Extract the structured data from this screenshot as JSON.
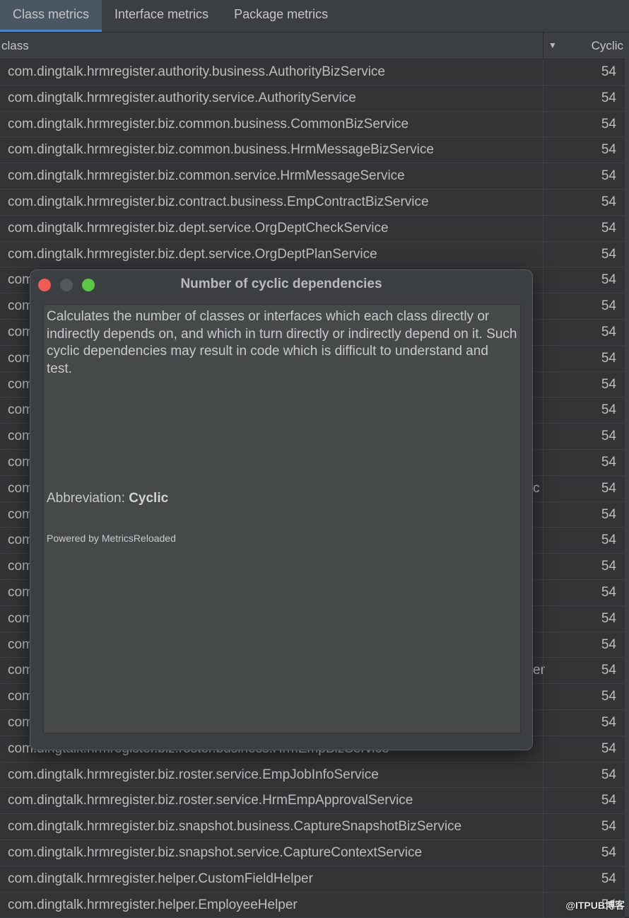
{
  "tabs": [
    {
      "label": "Class metrics",
      "active": true
    },
    {
      "label": "Interface metrics",
      "active": false
    },
    {
      "label": "Package metrics",
      "active": false
    }
  ],
  "table": {
    "columns": {
      "class": "class",
      "sort_icon": "sort-descending-icon",
      "cyclic": "Cyclic"
    },
    "rows": [
      {
        "name": "com.dingtalk.hrmregister.authority.business.AuthorityBizService",
        "value": "54"
      },
      {
        "name": "com.dingtalk.hrmregister.authority.service.AuthorityService",
        "value": "54"
      },
      {
        "name": "com.dingtalk.hrmregister.biz.common.business.CommonBizService",
        "value": "54"
      },
      {
        "name": "com.dingtalk.hrmregister.biz.common.business.HrmMessageBizService",
        "value": "54"
      },
      {
        "name": "com.dingtalk.hrmregister.biz.common.service.HrmMessageService",
        "value": "54"
      },
      {
        "name": "com.dingtalk.hrmregister.biz.contract.business.EmpContractBizService",
        "value": "54"
      },
      {
        "name": "com.dingtalk.hrmregister.biz.dept.service.OrgDeptCheckService",
        "value": "54"
      },
      {
        "name": "com.dingtalk.hrmregister.biz.dept.service.OrgDeptPlanService",
        "value": "54"
      },
      {
        "name": "com",
        "value": "54"
      },
      {
        "name": "com",
        "value": "54"
      },
      {
        "name": "com",
        "value": "54"
      },
      {
        "name": "com",
        "value": "54"
      },
      {
        "name": "com",
        "value": "54"
      },
      {
        "name": "com",
        "value": "54"
      },
      {
        "name": "com",
        "value": "54"
      },
      {
        "name": "com",
        "value": "54"
      },
      {
        "name": "com",
        "value": "54",
        "tail": "c"
      },
      {
        "name": "com",
        "value": "54"
      },
      {
        "name": "com",
        "value": "54"
      },
      {
        "name": "com",
        "value": "54"
      },
      {
        "name": "com",
        "value": "54"
      },
      {
        "name": "com",
        "value": "54"
      },
      {
        "name": "com",
        "value": "54"
      },
      {
        "name": "com",
        "value": "54",
        "tail": "er"
      },
      {
        "name": "com",
        "value": "54"
      },
      {
        "name": "com",
        "value": "54"
      },
      {
        "name": "com.dingtalk.hrmregister.biz.roster.business.HrmEmpBizService",
        "value": "54"
      },
      {
        "name": "com.dingtalk.hrmregister.biz.roster.service.EmpJobInfoService",
        "value": "54"
      },
      {
        "name": "com.dingtalk.hrmregister.biz.roster.service.HrmEmpApprovalService",
        "value": "54"
      },
      {
        "name": "com.dingtalk.hrmregister.biz.snapshot.business.CaptureSnapshotBizService",
        "value": "54"
      },
      {
        "name": "com.dingtalk.hrmregister.biz.snapshot.service.CaptureContextService",
        "value": "54"
      },
      {
        "name": "com.dingtalk.hrmregister.helper.CustomFieldHelper",
        "value": "54"
      },
      {
        "name": "com.dingtalk.hrmregister.helper.EmployeeHelper",
        "value": "54"
      }
    ]
  },
  "dialog": {
    "title": "Number of cyclic dependencies",
    "description": "Calculates the number of classes or interfaces which each class directly or indirectly depends on, and which in turn directly or indirectly depend on it. Such cyclic dependencies may result in code which is difficult to understand and test.",
    "abbreviation_label": "Abbreviation: ",
    "abbreviation": "Cyclic",
    "powered_by": "Powered by MetricsReloaded",
    "colors": {
      "close": "#ee5d55",
      "minimize": "#55585a",
      "zoom": "#5ac747"
    }
  },
  "watermark": "@ITPUB博客"
}
